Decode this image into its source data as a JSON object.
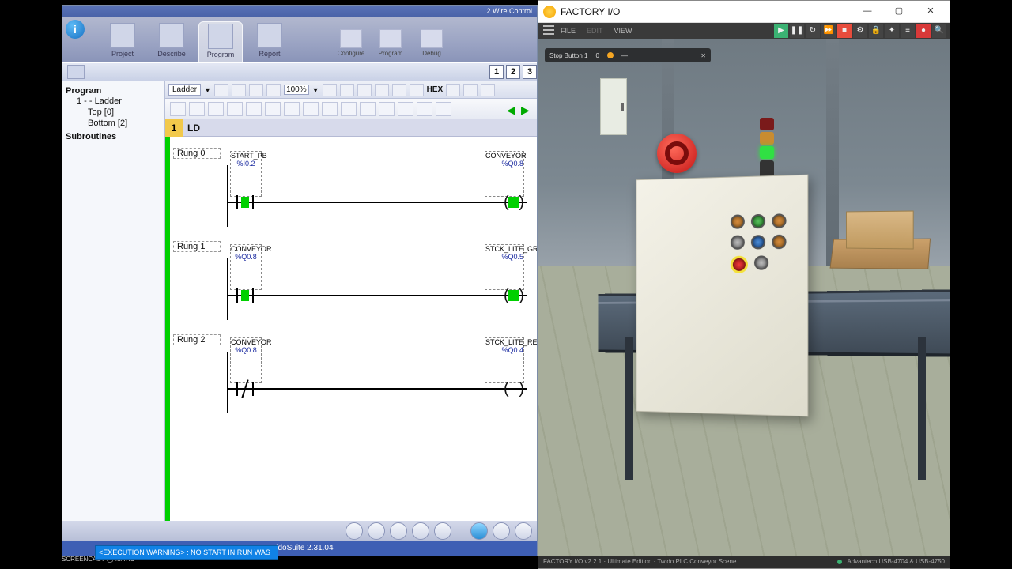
{
  "twido": {
    "title": "2 Wire Control",
    "tabs": {
      "project": "Project",
      "describe": "Describe",
      "program": "Program",
      "report": "Report",
      "configure": "Configure",
      "program2": "Program",
      "debug": "Debug"
    },
    "steps": [
      "1",
      "2",
      "3"
    ],
    "lang_select": "Ladder",
    "zoom": "100%",
    "hex": "HEX",
    "tree": {
      "root": "Program",
      "items": [
        "1 -  - Ladder"
      ],
      "subitems": [
        "Top [0]",
        "Bottom [2]"
      ],
      "sub_header": "Subroutines"
    },
    "ld_header_num": "1",
    "ld_header": "LD",
    "rungs": [
      {
        "title": "Rung 0",
        "left": {
          "name": "START_PB",
          "addr": "%I0.2",
          "type": "NO",
          "on": true
        },
        "right": {
          "name": "CONVEYOR",
          "addr": "%Q0.8",
          "type": "COIL",
          "on": true
        }
      },
      {
        "title": "Rung 1",
        "left": {
          "name": "CONVEYOR",
          "addr": "%Q0.8",
          "type": "NO",
          "on": true
        },
        "right": {
          "name": "STCK_LITE_GRN",
          "addr": "%Q0.5",
          "type": "COIL",
          "on": true
        }
      },
      {
        "title": "Rung 2",
        "left": {
          "name": "CONVEYOR",
          "addr": "%Q0.8",
          "type": "NC",
          "on": false
        },
        "right": {
          "name": "STCK_LITE_RED",
          "addr": "%Q0.4",
          "type": "COIL",
          "on": false
        }
      }
    ],
    "exec_warning": "<EXECUTION WARNING> :   NO START IN RUN WAS",
    "status": "TwidoSuite 2.31.04"
  },
  "factoryio": {
    "title": "FACTORY I/O",
    "menu": {
      "file": "FILE",
      "edit": "EDIT",
      "view": "VIEW"
    },
    "info_bar": {
      "label": "Stop Button 1",
      "value": "0",
      "dash": "—"
    },
    "footer_left": "FACTORY I/O v2.2.1 · Ultimate Edition · Twido PLC Conveyor Scene",
    "footer_right": "Advantech USB-4704 & USB-4750"
  },
  "screencast": "SCREENCAST ◯ MATIC"
}
